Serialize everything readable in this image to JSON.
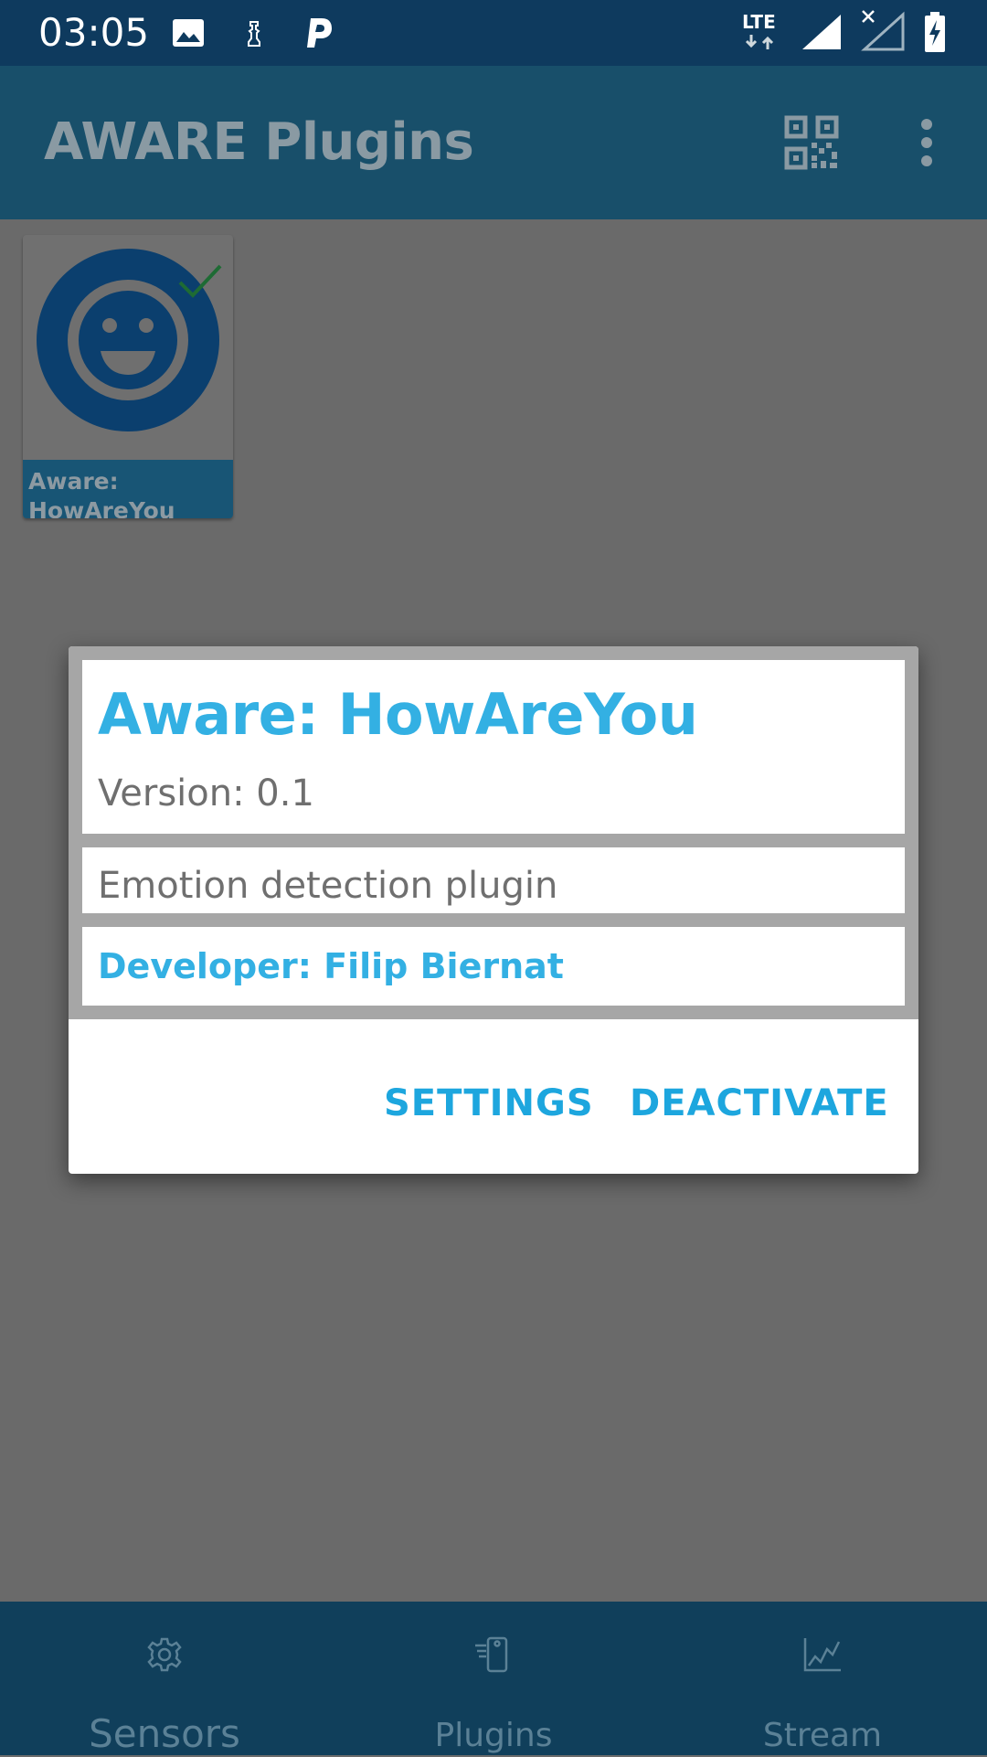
{
  "status_bar": {
    "time": "03:05",
    "network_label": "LTE",
    "icons": [
      "image-icon",
      "chess-icon",
      "parking-icon",
      "lte-data-icon",
      "signal-full-icon",
      "signal-no-data-icon",
      "battery-charging-icon"
    ]
  },
  "app_bar": {
    "title": "AWARE Plugins",
    "actions": [
      "qr-code-icon",
      "overflow-menu-icon"
    ]
  },
  "plugins": [
    {
      "label_line1": "Aware:",
      "label_line2": "HowAreYou",
      "active": true,
      "icon": "smiley-icon"
    }
  ],
  "dialog": {
    "title": "Aware: HowAreYou",
    "version": "Version: 0.1",
    "description": "Emotion detection plugin",
    "developer": "Developer: Filip Biernat",
    "settings_label": "SETTINGS",
    "deactivate_label": "DEACTIVATE"
  },
  "bottom_nav": {
    "items": [
      {
        "label": "Sensors",
        "icon": "gear-icon",
        "active": true
      },
      {
        "label": "Plugins",
        "icon": "phone-plugin-icon",
        "active": false
      },
      {
        "label": "Stream",
        "icon": "chart-icon",
        "active": false
      }
    ]
  },
  "colors": {
    "accent": "#33b0e3",
    "status_bar": "#0e3a5e",
    "app_bar": "#184f6a",
    "scrim": "#6a6a6a",
    "bottom_nav": "#103f5b"
  }
}
